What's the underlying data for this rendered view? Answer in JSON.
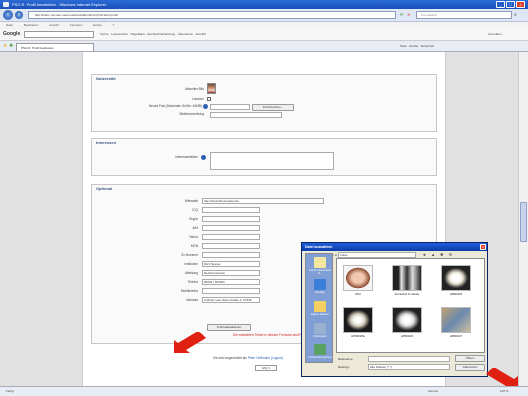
{
  "browser": {
    "title": "PSG R. Profil bearbeiten - Windows Internet Explorer",
    "address": "http://intern.pvc.de/~verein-admin/editprofil.php?id=1&m=profil",
    "live_search": "Live Search",
    "menu": [
      "Datei",
      "Bearbeiten",
      "Ansicht",
      "Favoriten",
      "Extras",
      "?"
    ],
    "tab_label": "PSG R. Profil bearbeiten",
    "google_label": "Google",
    "google_tools": "Suche  ·  Lesezeichen  ·  PageRank  ·  Rechtschreibprüfung  ·  Übersetzen  ·  AutoFill",
    "google_right": "Anmelden",
    "tab_tools": "Seite  ·  Extras  ·  Sicherheit",
    "status_left": "Fertig",
    "status_zone": "Internet",
    "status_zoom": "100 %"
  },
  "nutzerbild": {
    "title": "Nutzerbild",
    "current_label": "Aktuelles Bild",
    "delete_label": "Löschen",
    "new_label": "Neues Foto (Maximale Größe: 64MB)",
    "browse_btn": "Durchsuchen...",
    "caption_label": "Bildbeschreibung"
  },
  "interessen": {
    "title": "Interessen",
    "label": "Interessenfelder"
  },
  "optional": {
    "title": "Optional",
    "fields": [
      {
        "label": "Webseite",
        "value": "http://www.dhv-beispiel.de"
      },
      {
        "label": "ICQ",
        "value": ""
      },
      {
        "label": "Skype",
        "value": ""
      },
      {
        "label": "AIM",
        "value": ""
      },
      {
        "label": "Yahoo",
        "value": ""
      },
      {
        "label": "MSN",
        "value": ""
      },
      {
        "label": "ID-Nummer",
        "value": ""
      },
      {
        "label": "Institution",
        "value": "DHV Speyer"
      },
      {
        "label": "Abteilung",
        "value": "Rechenzentrum"
      },
      {
        "label": "Telefon",
        "value": "06232 / 654321"
      },
      {
        "label": "Mobiltelefon",
        "value": ""
      },
      {
        "label": "Adresse",
        "value": "Freiherr-vom-Stein-Straße 2, 67346"
      }
    ]
  },
  "submit_btn": "Profil aktualisieren",
  "required_note": "Die markierten Felder in diesem Formular sind Pflichtfelder. Diese müssen ausgefüllt werden.",
  "logged_in_prefix": "Sie sind angemeldet als",
  "logged_in_user": "Peter Hoffmann (Logout)",
  "faq_link": "FAQ 1",
  "dialog": {
    "title": "Datei auswählen",
    "lookin_label": "Suchen in:",
    "lookin_value": "Fotos",
    "places": [
      "Zuletzt verwendete D...",
      "Desktop",
      "Eigene Dateien",
      "Arbeitsplatz",
      "Netzwerkumgebung"
    ],
    "files": [
      "0016",
      "hernandob & mdiolay",
      "HPIM0425",
      "HPIM0425a",
      "HPIM0426",
      "HPIM0427"
    ],
    "filename_label": "Dateiname:",
    "filetype_label": "Dateityp:",
    "filetype_value": "Alle Dateien (*.*)",
    "open_btn": "Öffnen",
    "cancel_btn": "Abbrechen"
  },
  "colors": {
    "accent": "#2b5fb5",
    "arrow": "#e02010",
    "required": "#cc2222"
  }
}
